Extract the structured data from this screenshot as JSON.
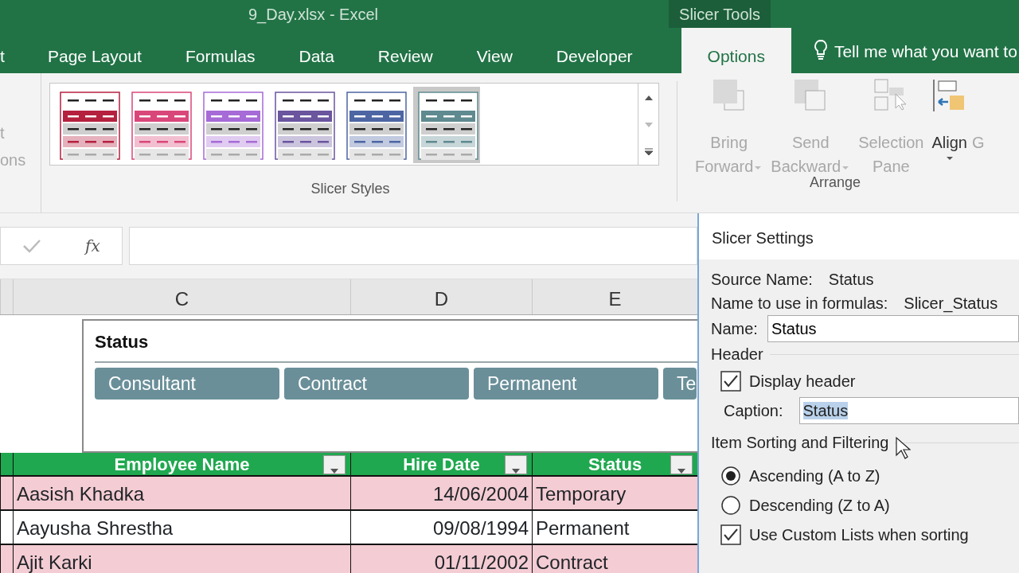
{
  "window": {
    "title": "9_Day.xlsx - Excel",
    "context_group": "Slicer Tools"
  },
  "tabs": [
    {
      "label": "t",
      "selected": false
    },
    {
      "label": "Page Layout",
      "selected": false
    },
    {
      "label": "Formulas",
      "selected": false
    },
    {
      "label": "Data",
      "selected": false
    },
    {
      "label": "Review",
      "selected": false
    },
    {
      "label": "View",
      "selected": false
    },
    {
      "label": "Developer",
      "selected": false
    },
    {
      "label": "Options",
      "selected": true
    }
  ],
  "tell_me": "Tell me what you want to",
  "ribbon": {
    "left_group_texts": [
      "t",
      "ons"
    ],
    "slicer_styles": [
      {
        "color": "#b5203f",
        "selected": false
      },
      {
        "color": "#d9477a",
        "selected": false
      },
      {
        "color": "#a66bd6",
        "selected": false
      },
      {
        "color": "#6a559e",
        "selected": false
      },
      {
        "color": "#4d66a3",
        "selected": false
      },
      {
        "color": "#5f8a8f",
        "selected": true
      }
    ],
    "slicer_styles_label": "Slicer Styles",
    "arrange": [
      {
        "kind": "bring",
        "lines": [
          "Bring",
          "Forward"
        ],
        "dropdown": true,
        "disabled": true
      },
      {
        "kind": "send",
        "lines": [
          "Send",
          "Backward"
        ],
        "dropdown": true,
        "disabled": true
      },
      {
        "kind": "pane",
        "lines": [
          "Selection",
          "Pane"
        ],
        "dropdown": false,
        "disabled": true
      },
      {
        "kind": "align",
        "lines": [
          "Align"
        ],
        "dropdown": true,
        "disabled": false
      }
    ],
    "arrange_label": "Arrange",
    "cut_button": "G"
  },
  "formula_bar": {
    "function_label": "fx"
  },
  "columns": [
    "C",
    "D",
    "E"
  ],
  "slicer": {
    "header": "Status",
    "items": [
      "Consultant",
      "Contract",
      "Permanent",
      "Te"
    ]
  },
  "table": {
    "columns": [
      "Employee Name",
      "Hire Date",
      "Status"
    ],
    "rows": [
      {
        "cells": [
          "Aasish Khadka",
          "14/06/2004",
          "Temporary"
        ],
        "banded": true
      },
      {
        "cells": [
          "Aayusha Shrestha",
          "09/08/1994",
          "Permanent"
        ],
        "banded": false
      },
      {
        "cells": [
          "Ajit Karki",
          "01/11/2002",
          "Contract"
        ],
        "banded": true
      }
    ]
  },
  "dialog": {
    "title": "Slicer Settings",
    "source_name_label": "Source Name:",
    "source_name": "Status",
    "formula_name_label": "Name to use in formulas:",
    "formula_name": "Slicer_Status",
    "name_label": "Name:",
    "name_value": "Status",
    "header_section": "Header",
    "display_header": {
      "label": "Display header",
      "checked": true
    },
    "caption_label": "Caption:",
    "caption_value": "Status",
    "sorting_section": "Item Sorting and Filtering",
    "sort_options": [
      {
        "kind": "radio",
        "label": "Ascending (A to Z)",
        "checked": true
      },
      {
        "kind": "radio",
        "label": "Descending (Z to A)",
        "checked": false
      },
      {
        "kind": "checkbox",
        "label": "Use Custom Lists when sorting",
        "checked": true
      }
    ]
  }
}
